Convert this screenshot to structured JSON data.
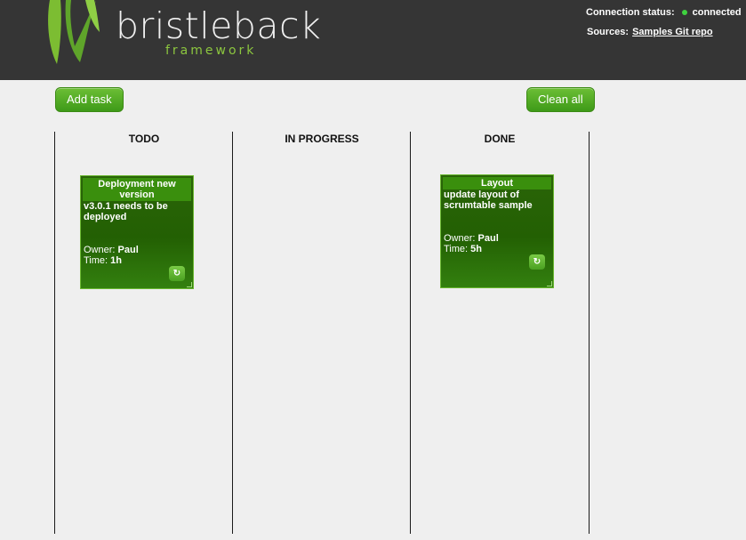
{
  "header": {
    "logo_text": "bristleback",
    "logo_subtext": "framework",
    "connection_label": "Connection status:",
    "connection_value": "connected",
    "sources_label": "Sources:",
    "sources_link": "Samples Git repo"
  },
  "toolbar": {
    "add_task": "Add task",
    "clean_all": "Clean all"
  },
  "columns": [
    {
      "title": "TODO"
    },
    {
      "title": "IN PROGRESS"
    },
    {
      "title": "DONE"
    }
  ],
  "cards": [
    {
      "title": "Deployment new version",
      "description": "v3.0.1 needs to be deployed",
      "owner_label": "Owner:",
      "owner": "Paul",
      "time_label": "Time:",
      "time": "1h"
    },
    {
      "title": "Layout",
      "description": "update layout of scrumtable sample",
      "owner_label": "Owner:",
      "owner": "Paul",
      "time_label": "Time:",
      "time": "5h"
    }
  ],
  "colors": {
    "header_bg": "#353535",
    "accent_green": "#4aa021",
    "card_green": "#236003",
    "status_dot": "#3fd23f"
  }
}
